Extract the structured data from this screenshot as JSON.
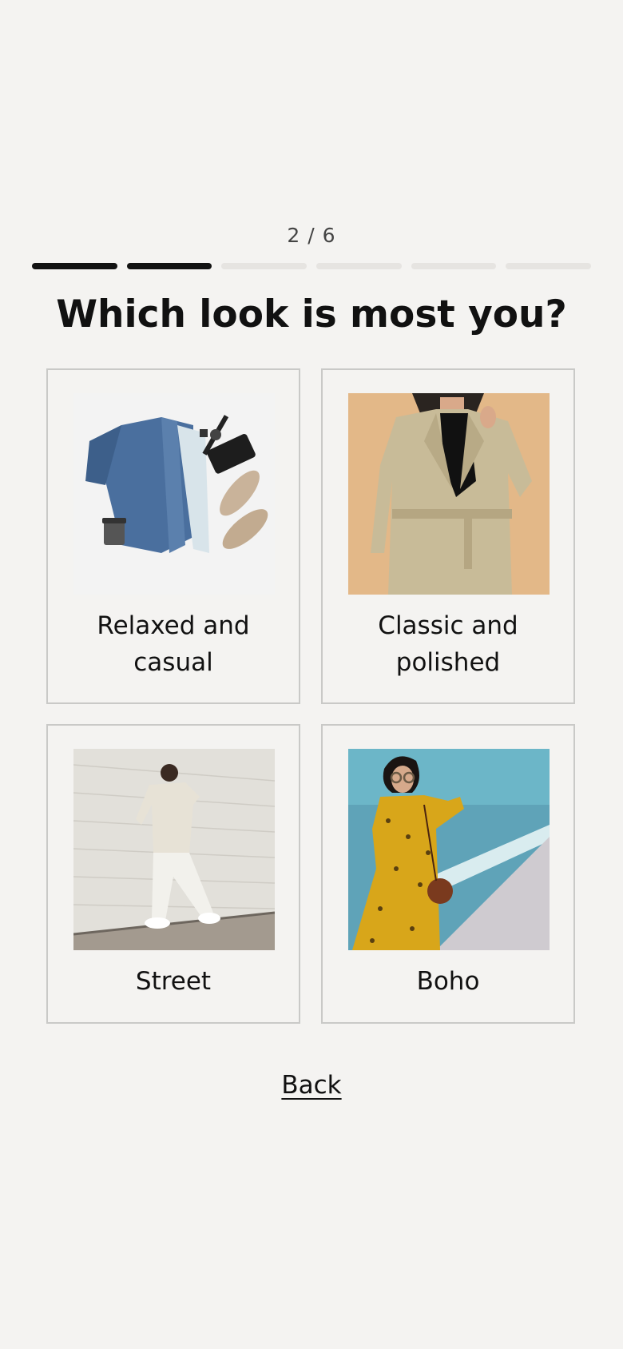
{
  "progress": {
    "label": "2 / 6",
    "current_step": 2,
    "total_steps": 6
  },
  "question": "Which look is most you?",
  "options": [
    {
      "label": "Relaxed and casual",
      "image": "denim-jacket-flatlay"
    },
    {
      "label": "Classic and polished",
      "image": "trench-coat-woman"
    },
    {
      "label": "Street",
      "image": "streetwear-man-walking"
    },
    {
      "label": "Boho",
      "image": "yellow-dress-beach-woman"
    }
  ],
  "back_label": "Back",
  "colors": {
    "background": "#f4f3f1",
    "progress_done": "#121212",
    "progress_todo": "#e6e4e1",
    "card_border": "#c9c9c7"
  }
}
